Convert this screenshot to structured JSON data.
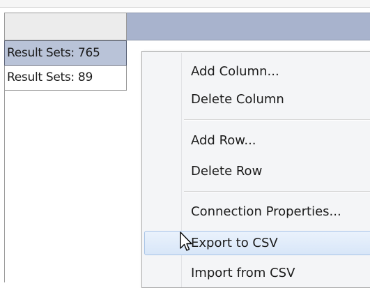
{
  "grid": {
    "rows": [
      {
        "label": "Result Sets: 765",
        "selected": true
      },
      {
        "label": "Result Sets: 89",
        "selected": false
      }
    ]
  },
  "context_menu": {
    "items": [
      {
        "label": "Add Column..."
      },
      {
        "label": "Delete Column"
      },
      {
        "label": "Add Row..."
      },
      {
        "label": "Delete Row"
      },
      {
        "label": "Connection Properties..."
      },
      {
        "label": "Export to CSV",
        "hovered": true
      },
      {
        "label": "Import from CSV"
      }
    ]
  },
  "colors": {
    "column_header": "#a8b3cd",
    "selected_row": "#b9c3d8",
    "menu_background": "#f4f5f7",
    "menu_hover": "#d8e6f8"
  },
  "cursor": {
    "icon": "arrow-pointer-icon"
  }
}
